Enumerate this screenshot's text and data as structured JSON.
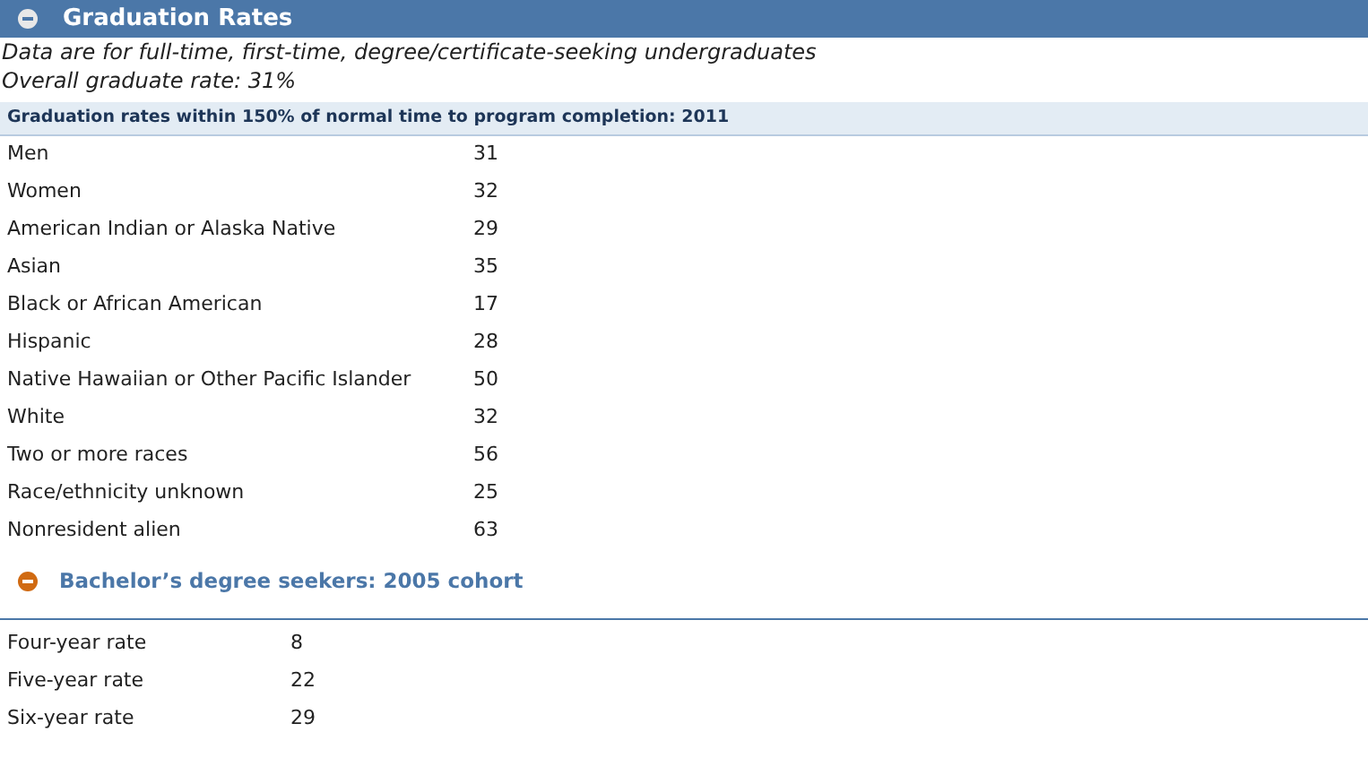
{
  "section": {
    "title": "Graduation Rates",
    "expanded": true
  },
  "notes": [
    "Data are for full-time, first-time, degree/certificate-seeking undergraduates",
    "Overall graduate rate: 31%"
  ],
  "table": {
    "caption": "Graduation rates within 150% of normal time to program completion: 2011",
    "rows": [
      {
        "label": "Men",
        "value": "31"
      },
      {
        "label": "Women",
        "value": "32"
      },
      {
        "label": "American Indian or Alaska Native",
        "value": "29"
      },
      {
        "label": "Asian",
        "value": "35"
      },
      {
        "label": "Black or African American",
        "value": "17"
      },
      {
        "label": "Hispanic",
        "value": "28"
      },
      {
        "label": "Native Hawaiian or Other Pacific Islander",
        "value": "50"
      },
      {
        "label": "White",
        "value": "32"
      },
      {
        "label": "Two or more races",
        "value": "56"
      },
      {
        "label": "Race/ethnicity unknown",
        "value": "25"
      },
      {
        "label": "Nonresident alien",
        "value": "63"
      }
    ]
  },
  "subsection": {
    "title": "Bachelor’s degree seekers: 2005 cohort",
    "expanded": true,
    "rows": [
      {
        "label": "Four-year rate",
        "value": "8"
      },
      {
        "label": "Five-year rate",
        "value": "22"
      },
      {
        "label": "Six-year rate",
        "value": "29"
      }
    ]
  }
}
